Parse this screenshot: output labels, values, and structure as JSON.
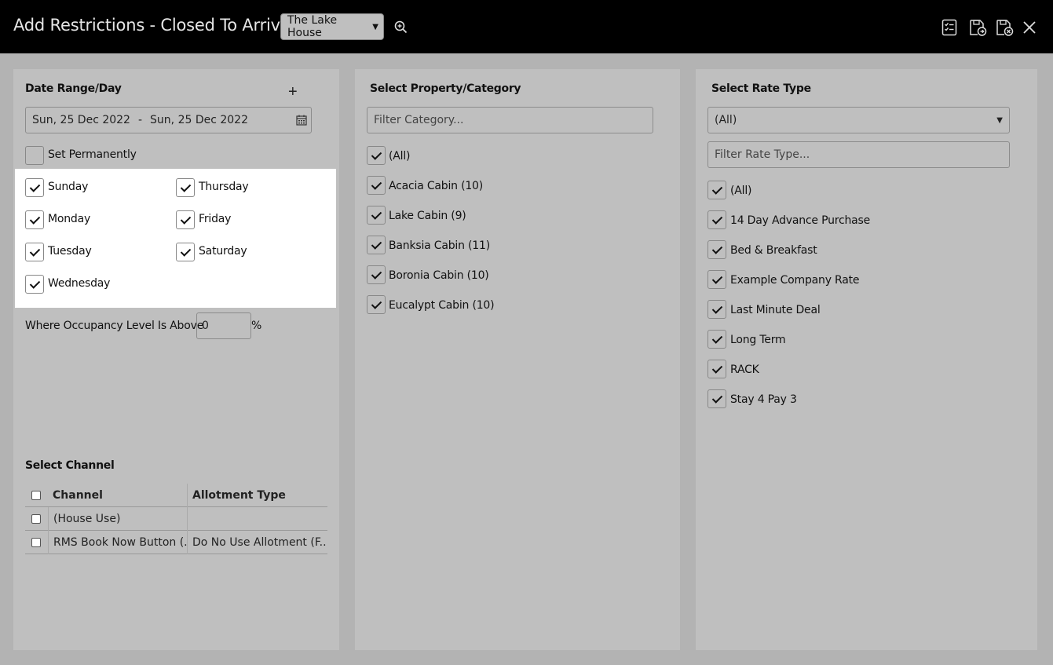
{
  "header": {
    "title": "Add Restrictions - Closed To Arrival",
    "property_selected": "The Lake House"
  },
  "date_panel": {
    "title": "Date Range/Day",
    "add_label": "+",
    "date_from": "Sun, 25 Dec 2022",
    "date_sep": "-",
    "date_to": "Sun, 25 Dec 2022",
    "set_permanently": "Set Permanently",
    "days": [
      "Sunday",
      "Monday",
      "Tuesday",
      "Wednesday",
      "Thursday",
      "Friday",
      "Saturday"
    ],
    "occupancy_label": "Where Occupancy Level Is Above",
    "occupancy_value": "0",
    "occupancy_unit": "%"
  },
  "channel_panel": {
    "title": "Select Channel",
    "col_channel": "Channel",
    "col_allotment": "Allotment Type",
    "rows": [
      {
        "channel": "(House Use)",
        "allotment": ""
      },
      {
        "channel": "RMS Book Now Button (...",
        "allotment": "Do No Use Allotment (F..."
      }
    ]
  },
  "category_panel": {
    "title": "Select Property/Category",
    "filter_placeholder": "Filter Category...",
    "items": [
      "(All)",
      "Acacia Cabin (10)",
      "Lake Cabin (9)",
      "Banksia Cabin (11)",
      "Boronia Cabin (10)",
      "Eucalypt Cabin (10)"
    ]
  },
  "rate_panel": {
    "title": "Select Rate Type",
    "select_value": "(All)",
    "filter_placeholder": "Filter Rate Type...",
    "items": [
      "(All)",
      "14 Day Advance Purchase",
      "Bed & Breakfast",
      "Example Company Rate",
      "Last Minute Deal",
      "Long Term",
      "RACK",
      "Stay 4 Pay 3"
    ]
  }
}
